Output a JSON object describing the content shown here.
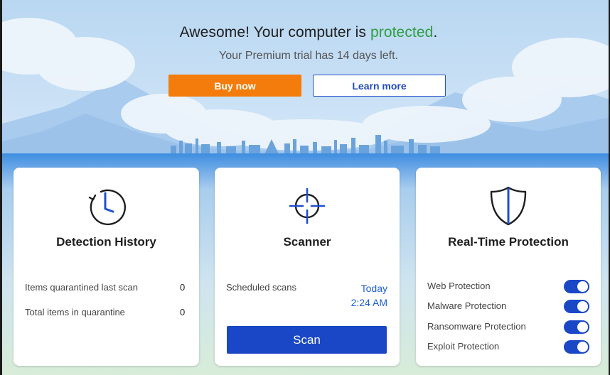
{
  "header": {
    "headline_prefix": "Awesome! Your computer is ",
    "headline_status": "protected",
    "headline_suffix": ".",
    "trial_text": "Your Premium trial has 14 days left.",
    "buy_label": "Buy now",
    "learn_label": "Learn more"
  },
  "cards": {
    "history": {
      "icon": "clock-history-icon",
      "title": "Detection History",
      "rows": [
        {
          "label": "Items quarantined last scan",
          "value": "0"
        },
        {
          "label": "Total items in quarantine",
          "value": "0"
        }
      ]
    },
    "scanner": {
      "icon": "crosshair-icon",
      "title": "Scanner",
      "scheduled_label": "Scheduled scans",
      "scheduled_day": "Today",
      "scheduled_time": "2:24 AM",
      "scan_label": "Scan"
    },
    "realtime": {
      "icon": "shield-icon",
      "title": "Real-Time Protection",
      "toggles": [
        {
          "label": "Web Protection",
          "on": true
        },
        {
          "label": "Malware Protection",
          "on": true
        },
        {
          "label": "Ransomware Protection",
          "on": true
        },
        {
          "label": "Exploit Protection",
          "on": true
        }
      ]
    }
  },
  "colors": {
    "accent": "#1a47c6",
    "buy": "#f47c0c",
    "protected": "#2e9e3f"
  }
}
